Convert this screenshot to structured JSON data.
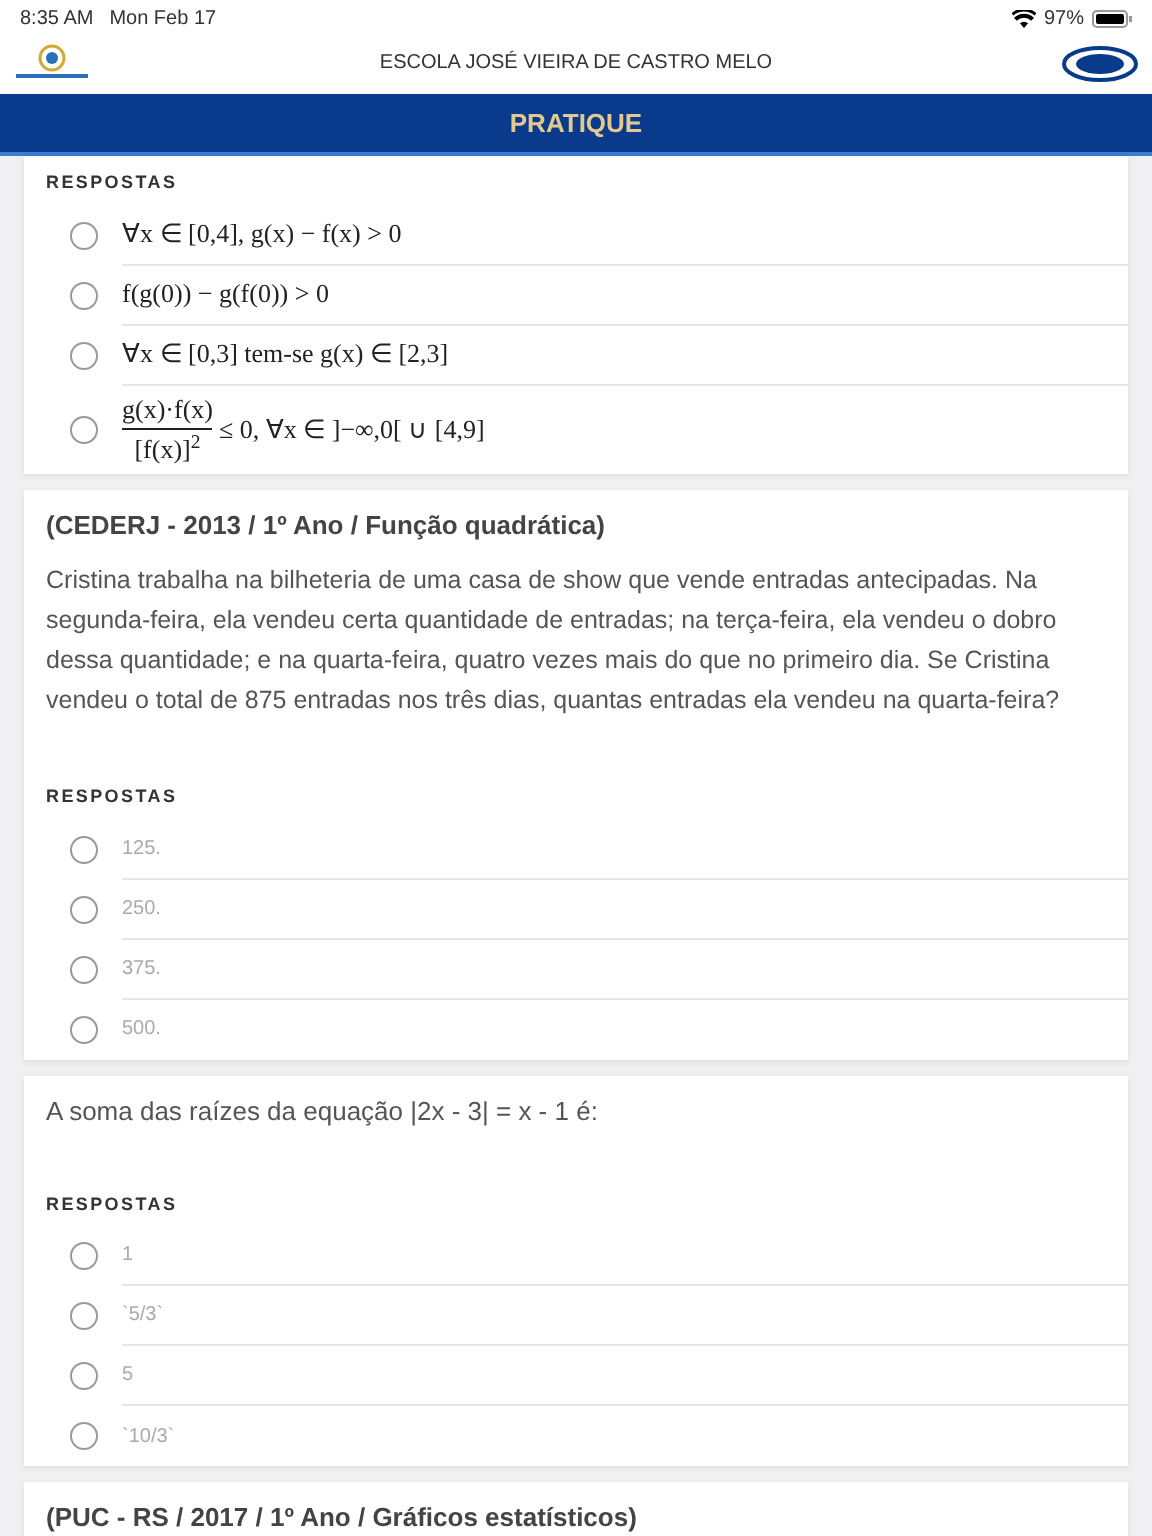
{
  "status_bar": {
    "time": "8:35 AM",
    "date": "Mon Feb 17",
    "battery": "97%"
  },
  "header": {
    "school": "ESCOLA JOSÉ VIEIRA DE CASTRO MELO"
  },
  "title_bar": {
    "title": "PRATIQUE"
  },
  "cards": [
    {
      "answers_label": "RESPOSTAS",
      "options": [
        {
          "kind": "formula",
          "text": "∀x ∈ [0,4], g(x) − f(x) > 0",
          "selected": false
        },
        {
          "kind": "formula",
          "text": "f(g(0)) − g(f(0)) > 0",
          "selected": false
        },
        {
          "kind": "formula",
          "text": "∀x ∈ [0,3] tem-se g(x) ∈ [2,3]",
          "selected": false
        },
        {
          "kind": "fraction",
          "numerator": "g(x)·f(x)",
          "denominator": "[f(x)]$^{2}$",
          "text": "≤ 0, ∀x ∈ ]−∞,0[ ∪ [4,9]",
          "selected": false
        }
      ]
    },
    {
      "source": "(CEDERJ - 2013 / 1º Ano / Função quadrática)",
      "question": "Cristina trabalha na bilheteria de uma casa de show que vende entradas antecipadas. Na segunda-feira, ela vendeu certa quantidade de entradas; na terça-feira, ela vendeu o dobro dessa quantidade; e na quarta-feira, quatro vezes mais do que no primeiro dia. Se Cristina vendeu o total de 875 entradas nos três dias, quantas entradas ela vendeu na quarta-feira?",
      "answers_label": "RESPOSTAS",
      "options": [
        {
          "kind": "plain",
          "text": "125.",
          "selected": false
        },
        {
          "kind": "plain",
          "text": "250.",
          "selected": false
        },
        {
          "kind": "plain",
          "text": "375.",
          "selected": false
        },
        {
          "kind": "plain",
          "text": "500.",
          "selected": false
        }
      ]
    },
    {
      "question": "A soma das raízes da equação |2x - 3| = x - 1 é:",
      "answers_label": "RESPOSTAS",
      "options": [
        {
          "kind": "plain",
          "text": "1",
          "selected": false
        },
        {
          "kind": "plain",
          "text": "`5/3`",
          "selected": false
        },
        {
          "kind": "plain",
          "text": "5",
          "selected": false
        },
        {
          "kind": "plain",
          "text": "`10/3`",
          "selected": false
        }
      ]
    },
    {
      "source": "(PUC - RS / 2017 / 1º Ano / Gráficos estatísticos)"
    }
  ]
}
